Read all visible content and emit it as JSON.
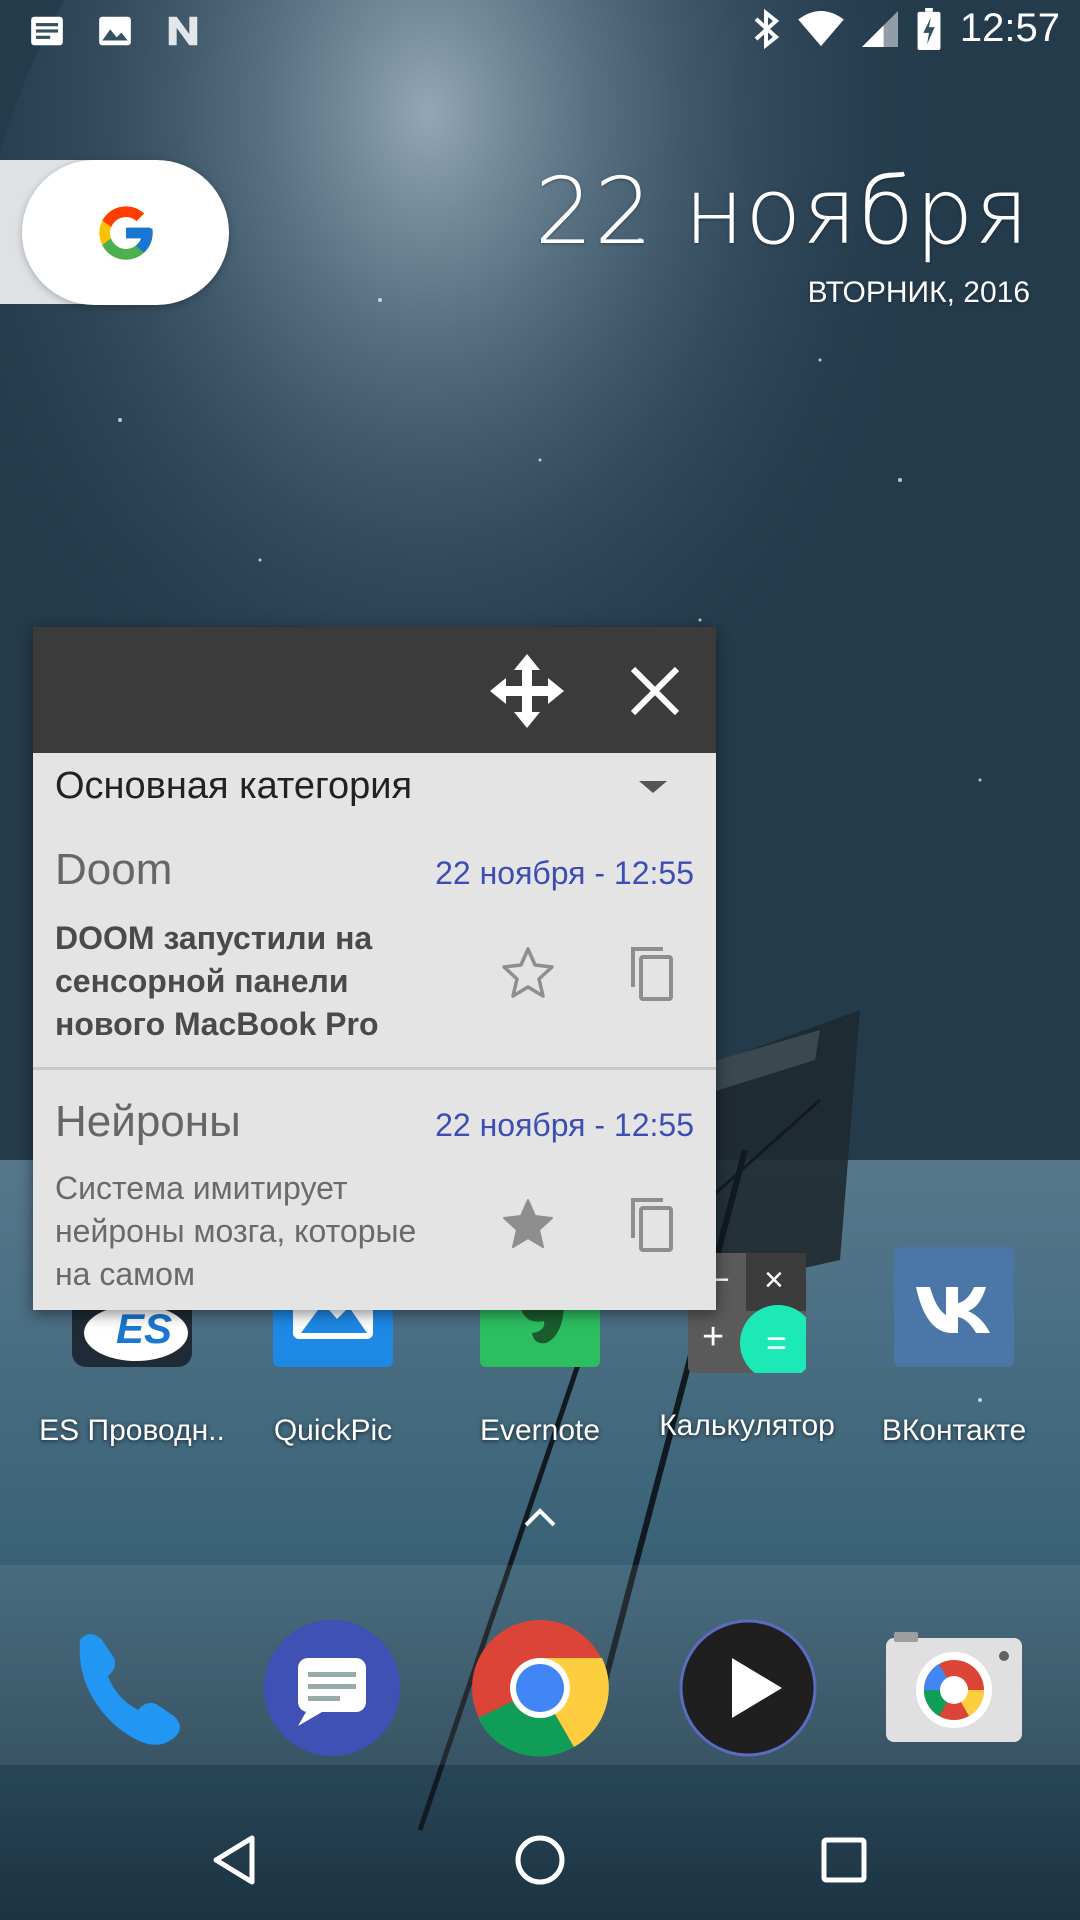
{
  "status_bar": {
    "time": "12:57",
    "left_icons": [
      "notification-text-icon",
      "image-icon",
      "n-icon"
    ],
    "right_icons": [
      "bluetooth-icon",
      "wifi-icon",
      "signal-icon",
      "battery-charging-icon"
    ]
  },
  "date_widget": {
    "date": "22 ноября",
    "weekday_year": "ВТОРНИК, 2016"
  },
  "apps": [
    {
      "label": "ES Проводн..",
      "icon": "es-explorer-icon"
    },
    {
      "label": "QuickPic",
      "icon": "quickpic-icon"
    },
    {
      "label": "Evernote",
      "icon": "evernote-icon"
    },
    {
      "label": "Калькулятор",
      "icon": "calculator-icon"
    },
    {
      "label": "ВКонтакте",
      "icon": "vk-icon"
    }
  ],
  "dock": [
    "phone-icon",
    "messages-icon",
    "chrome-icon",
    "play-music-icon",
    "camera-icon"
  ],
  "nav": [
    "back-icon",
    "home-icon",
    "recents-icon"
  ],
  "notes_widget": {
    "category": "Основная категория",
    "notes": [
      {
        "title": "Doom",
        "date": "22 ноября - 12:55",
        "body": "DOOM запустили на сенсорной панели нового MacBook Pro",
        "starred": false
      },
      {
        "title": "Нейроны",
        "date": "22 ноября - 12:55",
        "body": "Система имитирует нейроны мозга, которые на самом",
        "starred": true
      }
    ]
  },
  "calculator_symbols": {
    "minus": "−",
    "times": "×",
    "plus": "+",
    "equals": "="
  },
  "colors": {
    "note_date": "#3c4db3",
    "widget_header": "#3b3b3b",
    "calc_accent": "#1de9b6"
  }
}
